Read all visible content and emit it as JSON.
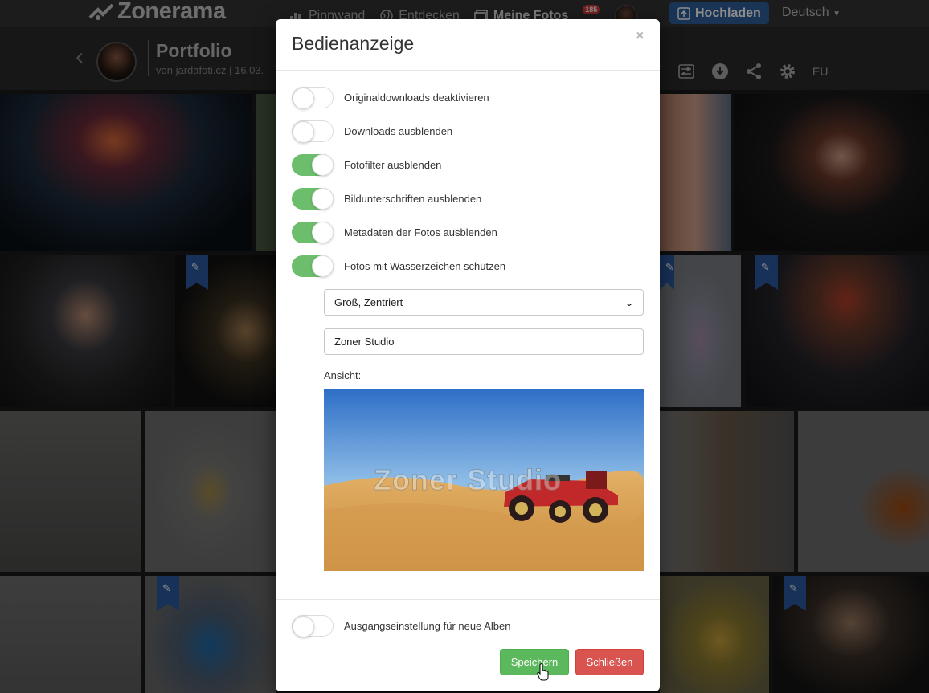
{
  "header": {
    "logo": "Zonerama",
    "nav": [
      {
        "label": "Pinnwand",
        "icon": "chart-icon"
      },
      {
        "label": "Entdecken",
        "icon": "globe-icon"
      },
      {
        "label": "Meine Fotos",
        "icon": "photos-icon"
      }
    ],
    "notification_count": "185",
    "upload_label": "Hochladen",
    "language": "Deutsch"
  },
  "album": {
    "title": "Portfolio",
    "subtitle": "von jardafoti.cz | 16.03.",
    "region": "EU"
  },
  "modal": {
    "title": "Bedienanzeige",
    "close_symbol": "×",
    "toggles": [
      {
        "label": "Originaldownloads deaktivieren",
        "on": false
      },
      {
        "label": "Downloads ausblenden",
        "on": false
      },
      {
        "label": "Fotofilter ausblenden",
        "on": true
      },
      {
        "label": "Bildunterschriften ausblenden",
        "on": true
      },
      {
        "label": "Metadaten der Fotos ausblenden",
        "on": true
      },
      {
        "label": "Fotos mit Wasserzeichen schützen",
        "on": true
      }
    ],
    "watermark_position": "Groß, Zentriert",
    "watermark_text": "Zoner Studio",
    "preview_label": "Ansicht:",
    "default_toggle": {
      "label": "Ausgangseinstellung für neue Alben",
      "on": false
    },
    "save_label": "Speichern",
    "close_label": "Schließen"
  },
  "colors": {
    "toggle_on": "#6cbe6c",
    "save": "#5cb85c",
    "close": "#d9534f",
    "upload": "#2f5f9c"
  }
}
